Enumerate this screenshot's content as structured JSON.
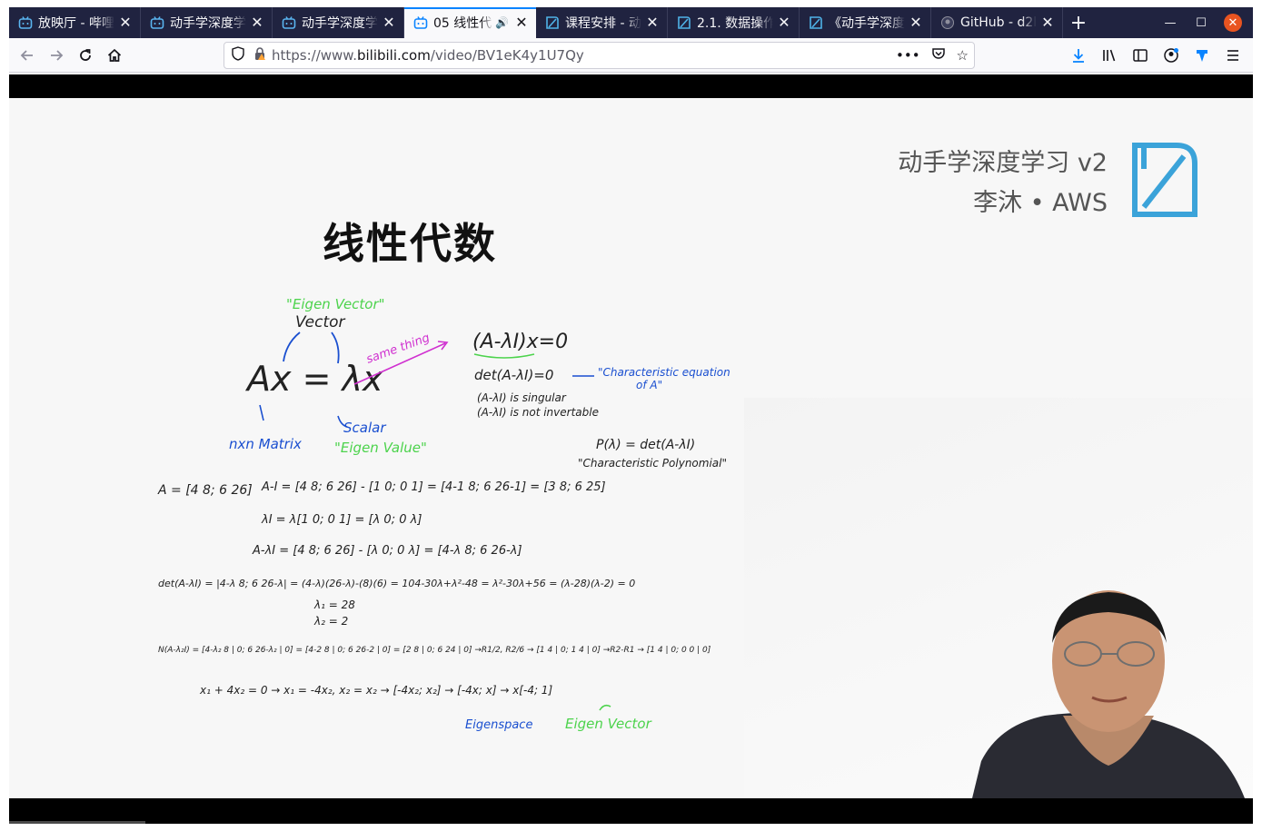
{
  "browser": {
    "tabs": [
      {
        "title": "放映厅 - 哔哩",
        "icon": "bilibili-icon",
        "active": false
      },
      {
        "title": "动手学深度学",
        "icon": "bilibili-icon",
        "active": false
      },
      {
        "title": "动手学深度学",
        "icon": "bilibili-icon",
        "active": false
      },
      {
        "title": "05 线性代",
        "icon": "bilibili-icon",
        "active": true,
        "audio": true
      },
      {
        "title": "课程安排 - 动",
        "icon": "d2l-icon",
        "active": false
      },
      {
        "title": "2.1. 数据操作",
        "icon": "d2l-icon",
        "active": false
      },
      {
        "title": "《动手学深度",
        "icon": "d2l-icon",
        "active": false
      },
      {
        "title": "GitHub - d2l-",
        "icon": "github-icon",
        "active": false
      }
    ],
    "url": {
      "prefix": "https://www.",
      "host": "bilibili.com",
      "path": "/video/BV1eK4y1U7Qy"
    }
  },
  "slide": {
    "brand_line1": "动手学深度学习 v2",
    "brand_line2": "李沐 • AWS",
    "title": "线性代数",
    "notes": {
      "eigen_vector_label": "\"Eigen Vector\"",
      "vector_label": "Vector",
      "main_eq": "Ax = λx",
      "same_thing": "same thing",
      "char_eq_top": "(A-λI)x=0",
      "det_eq": "det(A-λI)=0",
      "char_eq_label": "\"Characteristic equation",
      "char_eq_label2": "of A\"",
      "singular": "(A-λI) is singular",
      "not_invertable": "(A-λI) is not invertable",
      "nxn_matrix": "nxn Matrix",
      "scalar": "Scalar",
      "eigen_value": "\"Eigen Value\"",
      "p_lambda": "P(λ) = det(A-λI)",
      "char_poly": "\"Characteristic Polynomial\"",
      "row_a": "A = [4 8; 6 26]",
      "row_a_minus_i": "A-I = [4 8; 6 26] - [1 0; 0 1] = [4-1 8; 6 26-1] = [3 8; 6 25]",
      "row_lambda_i": "λI = λ[1 0; 0 1] = [λ 0; 0 λ]",
      "row_a_minus_li": "A-λI = [4 8; 6 26] - [λ 0; 0 λ] = [4-λ 8; 6 26-λ]",
      "row_det": "det(A-λI) = |4-λ 8; 6 26-λ| = (4-λ)(26-λ)-(8)(6) = 104-30λ+λ²-48 = λ²-30λ+56 = (λ-28)(λ-2) = 0",
      "lambda1": "λ₁ = 28",
      "lambda2": "λ₂ = 2",
      "row_null": "N(A-λ₂I) = [4-λ₂ 8 | 0; 6 26-λ₂ | 0] = [4-2 8 | 0; 6 26-2 | 0] = [2 8 | 0; 6 24 | 0] →R1/2, R2/6 → [1 4 | 0; 1 4 | 0] →R2-R1 → [1 4 | 0; 0 0 | 0]",
      "row_solution": "x₁ + 4x₂ = 0 → x₁ = -4x₂, x₂ = x₂ → [-4x₂; x₂] → [-4x; x] → x[-4; 1]",
      "eigenspace": "Eigenspace",
      "eigen_vector": "Eigen Vector"
    }
  }
}
